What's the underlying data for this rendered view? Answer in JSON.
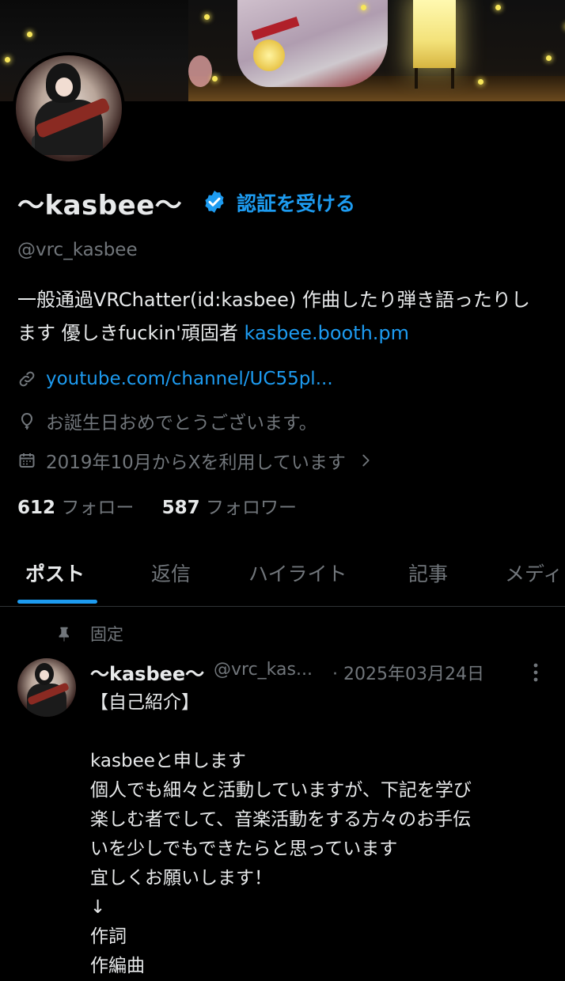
{
  "profile": {
    "display_name": "〜kasbee〜",
    "verify_label": "認証を受ける",
    "handle": "@vrc_kasbee",
    "bio_text": "一般通過VRChatter(id:kasbee) 作曲したり弾き語ったりします 優しきfuckin'頑固者 ",
    "bio_link": "kasbee.booth.pm",
    "website": "youtube.com/channel/UC55pl...",
    "birthday": "お誕生日おめでとうございます。",
    "joined": "2019年10月からXを利用しています"
  },
  "stats": {
    "following_count": "612",
    "following_label": "フォロー",
    "followers_count": "587",
    "followers_label": "フォロワー"
  },
  "tabs": [
    {
      "label": "ポスト",
      "active": true
    },
    {
      "label": "返信",
      "active": false
    },
    {
      "label": "ハイライト",
      "active": false
    },
    {
      "label": "記事",
      "active": false
    },
    {
      "label": "メディ",
      "active": false
    }
  ],
  "pinned_post": {
    "pinned_label": "固定",
    "author_name": "〜kasbee〜",
    "author_handle": "@vrc_kas...",
    "date": "· 2025年03月24日",
    "body": "【自己紹介】\n\nkasbeeと申します\n個人でも細々と活動していますが、下記を学び\n楽しむ者でして、音楽活動をする方々のお手伝\nいを少しでもできたらと思っています\n宜しくお願いします！\n↓\n作詞\n作編曲"
  },
  "colors": {
    "background": "#000000",
    "text_primary": "#e7e9ea",
    "text_secondary": "#71767b",
    "accent": "#1d9bf0",
    "divider": "#2f3336"
  },
  "icons": [
    "verified-badge-icon",
    "link-icon",
    "balloon-icon",
    "calendar-icon",
    "chevron-right-icon",
    "pin-icon",
    "more-vertical-icon"
  ]
}
